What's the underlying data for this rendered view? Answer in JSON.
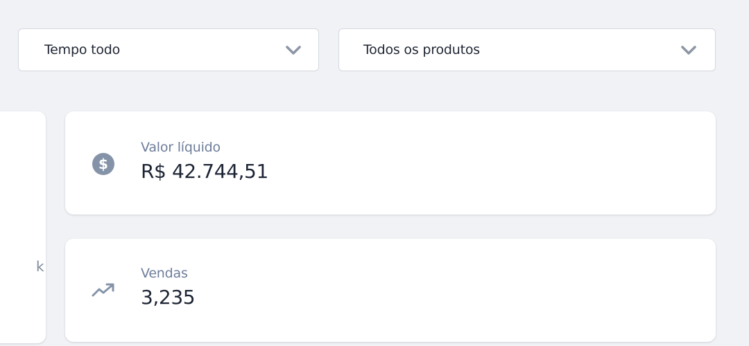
{
  "filters": {
    "period": {
      "value": "Tempo todo",
      "icon": "chevron-down-icon"
    },
    "product": {
      "value": "Todos os produtos",
      "icon": "chevron-down-icon"
    }
  },
  "left_card": {
    "partial_text": "k"
  },
  "metrics": {
    "net_value": {
      "label": "Valor líquido",
      "value": "R$ 42.744,51",
      "icon": "dollar-circle-icon"
    },
    "sales": {
      "label": "Vendas",
      "value": "3,235",
      "icon": "trending-up-icon"
    }
  },
  "colors": {
    "background": "#f1f2f5",
    "card": "#ffffff",
    "label": "#6d7d99",
    "value": "#1c2333",
    "icon": "#8593a8",
    "border": "#d3d7de"
  }
}
